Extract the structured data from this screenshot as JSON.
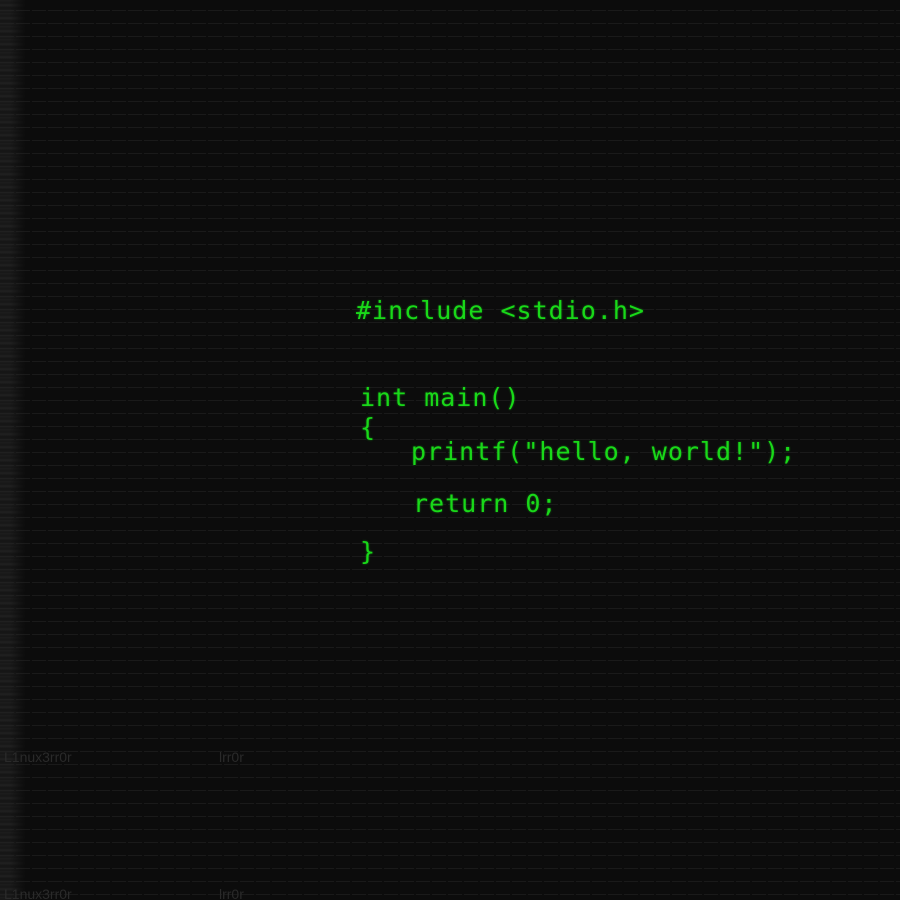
{
  "colors": {
    "background": "#0c0c0c",
    "code_text": "#19d919",
    "watermark_text": "#2a2a2a"
  },
  "code": {
    "lines": [
      "#include <stdio.h>",
      "int main()",
      "{",
      "printf(\"hello, world!\");",
      "return 0;",
      "}"
    ]
  },
  "watermarks": [
    "L1nux3rr0r",
    "lrr0r",
    "L1nux3rr0r",
    "lrr0r"
  ]
}
